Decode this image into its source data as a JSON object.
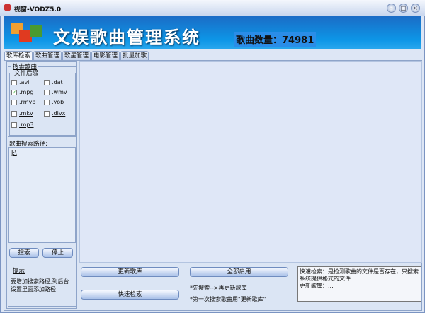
{
  "window": {
    "title": "视窗-VODZ5.0",
    "controls": [
      "minimize",
      "maximize",
      "close"
    ]
  },
  "banner": {
    "app_title": "文娱歌曲管理系统",
    "song_count_label": "歌曲数量：",
    "song_count": "74981"
  },
  "tabs": [
    {
      "label": "歌库检索",
      "active": true
    },
    {
      "label": "歌曲管理"
    },
    {
      "label": "歌星管理"
    },
    {
      "label": "电影管理"
    },
    {
      "label": "批量加歌"
    }
  ],
  "search": {
    "group_label": "搜索歌曲",
    "suffix_label": "文件后缀",
    "extensions": [
      {
        "label": ".avi",
        "checked": false
      },
      {
        "label": ".dat",
        "checked": false
      },
      {
        "label": ".mpg",
        "checked": true
      },
      {
        "label": ".wmv",
        "checked": false
      },
      {
        "label": ".rmvb",
        "checked": false
      },
      {
        "label": ".vob",
        "checked": false
      },
      {
        "label": ".mkv",
        "checked": false
      },
      {
        "label": ".divx",
        "checked": false
      },
      {
        "label": ".mp3",
        "checked": false
      }
    ],
    "path_label": "歌曲搜索路径:",
    "paths": [
      "J:\\"
    ],
    "search_button": "搜索",
    "stop_button": "停止"
  },
  "tips": {
    "label": "提示",
    "text": "要增加搜索路径,到后台设置里面添加路径"
  },
  "bottom": {
    "update_button": "更新歌库",
    "quick_button": "快速检索",
    "enable_all_button": "全部启用",
    "note1": "*先搜索-->再更新歌库",
    "note2": "*第一次搜索歌曲用\"更新歌库\"",
    "info": "快速检索：是检测歌曲的文件是否存在，只搜索系统提供格式的文件\n更新歌库：..."
  }
}
